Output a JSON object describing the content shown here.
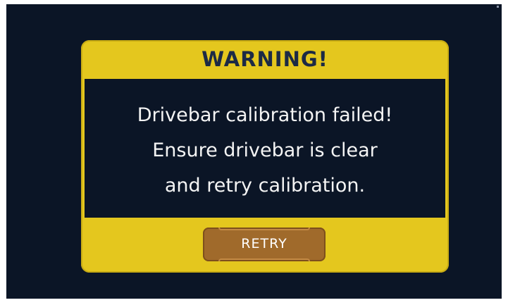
{
  "dialog": {
    "title": "WARNING!",
    "message_lines": [
      "Drivebar calibration failed!",
      "Ensure drivebar is clear",
      "and retry calibration."
    ],
    "retry_label": "RETRY"
  },
  "colors": {
    "screen_background": "#0b1526",
    "dialog_frame": "#e4c71e",
    "title_text": "#1c2a45",
    "message_text": "#f4f4f4",
    "button_fill": "#a06a2b"
  }
}
